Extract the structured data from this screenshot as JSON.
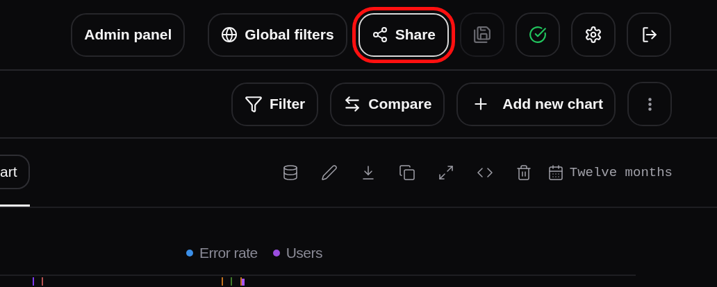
{
  "header": {
    "buttons": [
      {
        "label": "Admin panel",
        "highlighted": false
      },
      {
        "label": "Global filters",
        "highlighted": false
      },
      {
        "label": "Share",
        "highlighted": true
      }
    ],
    "icon_buttons": [
      {
        "disabled": true
      },
      {
        "disabled": false
      },
      {
        "disabled": false
      },
      {
        "disabled": false
      }
    ]
  },
  "toolbar": {
    "buttons": [
      {
        "label": "Filter"
      },
      {
        "label": "Compare"
      },
      {
        "label": "Add new chart"
      }
    ]
  },
  "chart_panel": {
    "tabs": [
      {
        "label": "art",
        "selected": true
      }
    ],
    "date_range": "Twelve months",
    "legend": [
      {
        "name": "Error rate",
        "color": "#3b8fe8"
      },
      {
        "name": "Users",
        "color": "#9b4de0"
      }
    ]
  }
}
